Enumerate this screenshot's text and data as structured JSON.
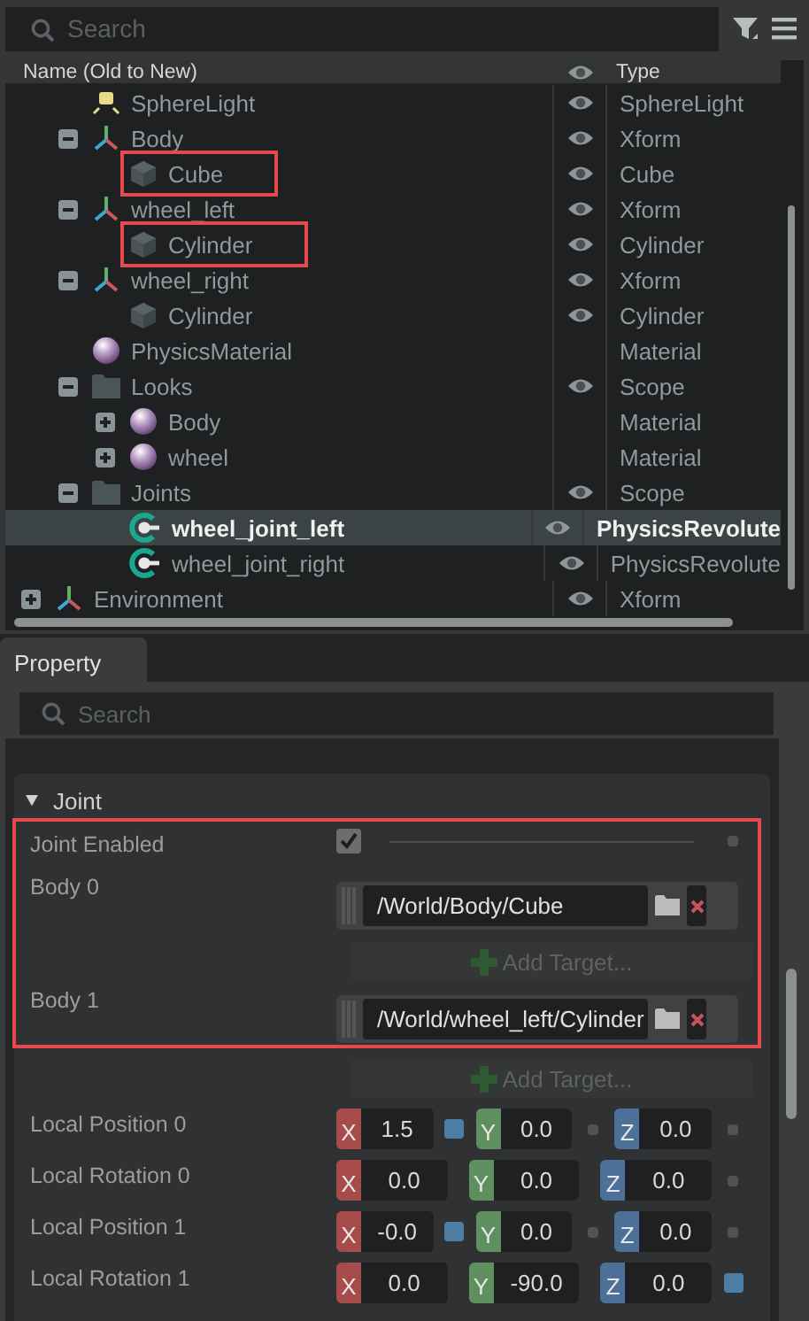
{
  "stage": {
    "search": {
      "placeholder": "Search"
    },
    "columns": {
      "name": "Name (Old to New)",
      "type": "Type"
    },
    "tree": {
      "rows_under_scrolled_parent": [
        {
          "name": "SphereLight",
          "type": "SphereLight",
          "kind": "light",
          "visible": true,
          "selected": false,
          "highlighted": false
        },
        {
          "name": "Body",
          "type": "Xform",
          "kind": "xform",
          "expanded": true,
          "visible": true,
          "selected": false,
          "highlighted": false,
          "children": [
            {
              "name": "Cube",
              "type": "Cube",
              "kind": "mesh",
              "visible": true,
              "selected": false,
              "highlighted": true
            }
          ]
        },
        {
          "name": "wheel_left",
          "type": "Xform",
          "kind": "xform",
          "expanded": true,
          "visible": true,
          "selected": false,
          "highlighted": false,
          "children": [
            {
              "name": "Cylinder",
              "type": "Cylinder",
              "kind": "mesh",
              "visible": true,
              "selected": false,
              "highlighted": true
            }
          ]
        },
        {
          "name": "wheel_right",
          "type": "Xform",
          "kind": "xform",
          "expanded": true,
          "visible": true,
          "selected": false,
          "highlighted": false,
          "children": [
            {
              "name": "Cylinder",
              "type": "Cylinder",
              "kind": "mesh",
              "visible": true,
              "selected": false,
              "highlighted": false
            }
          ]
        },
        {
          "name": "PhysicsMaterial",
          "type": "Material",
          "kind": "material",
          "visible": false,
          "selected": false,
          "highlighted": false
        },
        {
          "name": "Looks",
          "type": "Scope",
          "kind": "folder",
          "expanded": true,
          "visible": true,
          "selected": false,
          "highlighted": false,
          "children": [
            {
              "name": "Body",
              "type": "Material",
              "kind": "material",
              "expanded": false,
              "visible": false,
              "selected": false,
              "highlighted": false
            },
            {
              "name": "wheel",
              "type": "Material",
              "kind": "material",
              "expanded": false,
              "visible": false,
              "selected": false,
              "highlighted": false
            }
          ]
        },
        {
          "name": "Joints",
          "type": "Scope",
          "kind": "folder",
          "expanded": true,
          "visible": true,
          "selected": false,
          "highlighted": false,
          "children": [
            {
              "name": "wheel_joint_left",
              "type": "PhysicsRevolute",
              "kind": "joint",
              "visible": true,
              "selected": true,
              "highlighted": false
            },
            {
              "name": "wheel_joint_right",
              "type": "PhysicsRevolute",
              "kind": "joint",
              "visible": true,
              "selected": false,
              "highlighted": false
            }
          ]
        }
      ],
      "root_rows": [
        {
          "name": "Environment",
          "type": "Xform",
          "kind": "xform",
          "expanded": false,
          "visible": true,
          "selected": false,
          "highlighted": false
        }
      ]
    }
  },
  "property": {
    "tab": {
      "label": "Property",
      "selected": true
    },
    "search": {
      "placeholder": "Search"
    },
    "group": {
      "title": "Joint",
      "expanded": true
    },
    "rows": [
      {
        "kind": "checkbox",
        "label": "Joint Enabled",
        "checked": true,
        "modified": false,
        "highlighted": true
      },
      {
        "kind": "targets",
        "label": "Body 0",
        "targets": [
          "/World/Body/Cube"
        ],
        "highlighted": true
      },
      {
        "kind": "add",
        "label": "Add Target...",
        "highlighted": true
      },
      {
        "kind": "targets",
        "label": "Body 1",
        "targets": [
          "/World/wheel_left/Cylinder"
        ],
        "highlighted": true
      },
      {
        "kind": "add",
        "label": "Add Target...",
        "highlighted": false
      },
      {
        "kind": "vector",
        "label": "Local Position 0",
        "highlighted": false,
        "components": [
          {
            "axis": "X",
            "value": "1.5",
            "modified": true
          },
          {
            "axis": "Y",
            "value": "0.0",
            "modified": false
          },
          {
            "axis": "Z",
            "value": "0.0",
            "modified": false
          }
        ]
      },
      {
        "kind": "vector",
        "label": "Local Rotation 0",
        "highlighted": false,
        "components": [
          {
            "axis": "X",
            "value": "0.0"
          },
          {
            "axis": "Y",
            "value": "0.0"
          },
          {
            "axis": "Z",
            "value": "0.0",
            "modified": false
          }
        ]
      },
      {
        "kind": "vector",
        "label": "Local Position 1",
        "highlighted": false,
        "components": [
          {
            "axis": "X",
            "value": "-0.0",
            "modified": true
          },
          {
            "axis": "Y",
            "value": "0.0",
            "modified": false
          },
          {
            "axis": "Z",
            "value": "0.0",
            "modified": false
          }
        ]
      },
      {
        "kind": "vector",
        "label": "Local Rotation 1",
        "highlighted": false,
        "components": [
          {
            "axis": "X",
            "value": "0.0"
          },
          {
            "axis": "Y",
            "value": "-90.0"
          },
          {
            "axis": "Z",
            "value": "0.0",
            "modified": true
          }
        ]
      }
    ]
  }
}
